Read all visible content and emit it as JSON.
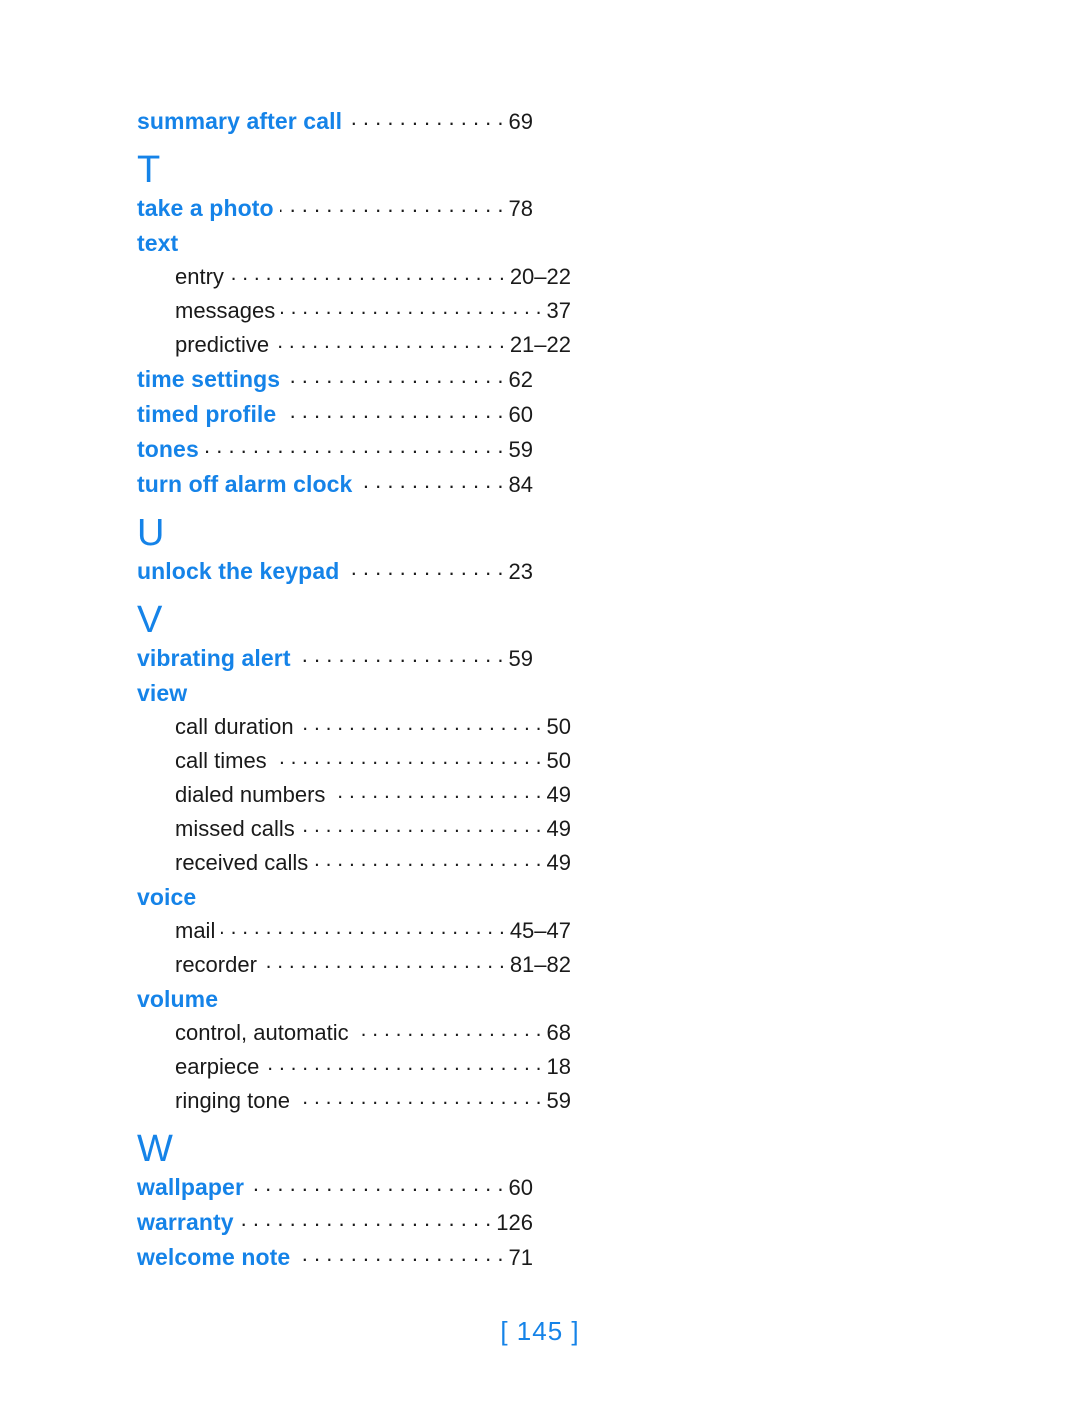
{
  "document": {
    "type": "index",
    "page_marker": "[ 145 ]"
  },
  "blocks": [
    {
      "kind": "entry",
      "level": "main",
      "label": "summary after call",
      "page": "69"
    },
    {
      "kind": "section",
      "letter": "T"
    },
    {
      "kind": "entry",
      "level": "main",
      "label": "take a photo",
      "page": "78"
    },
    {
      "kind": "group",
      "label": "text"
    },
    {
      "kind": "entry",
      "level": "sub",
      "label": "entry",
      "page": "20–22"
    },
    {
      "kind": "entry",
      "level": "sub",
      "label": "messages",
      "page": "37"
    },
    {
      "kind": "entry",
      "level": "sub",
      "label": "predictive",
      "page": "21–22"
    },
    {
      "kind": "entry",
      "level": "main",
      "label": "time settings",
      "page": "62"
    },
    {
      "kind": "entry",
      "level": "main",
      "label": "timed profile",
      "page": "60"
    },
    {
      "kind": "entry",
      "level": "main",
      "label": "tones",
      "page": "59"
    },
    {
      "kind": "entry",
      "level": "main",
      "label": "turn off alarm clock",
      "page": "84"
    },
    {
      "kind": "section",
      "letter": "U"
    },
    {
      "kind": "entry",
      "level": "main",
      "label": "unlock the keypad",
      "page": "23"
    },
    {
      "kind": "section",
      "letter": "V"
    },
    {
      "kind": "entry",
      "level": "main",
      "label": "vibrating alert",
      "page": "59"
    },
    {
      "kind": "group",
      "label": "view"
    },
    {
      "kind": "entry",
      "level": "sub",
      "label": "call duration",
      "page": "50"
    },
    {
      "kind": "entry",
      "level": "sub",
      "label": "call times",
      "page": "50"
    },
    {
      "kind": "entry",
      "level": "sub",
      "label": "dialed numbers",
      "page": "49"
    },
    {
      "kind": "entry",
      "level": "sub",
      "label": "missed calls",
      "page": "49"
    },
    {
      "kind": "entry",
      "level": "sub",
      "label": "received calls",
      "page": "49"
    },
    {
      "kind": "group",
      "label": "voice"
    },
    {
      "kind": "entry",
      "level": "sub",
      "label": "mail",
      "page": "45–47"
    },
    {
      "kind": "entry",
      "level": "sub",
      "label": "recorder",
      "page": "81–82"
    },
    {
      "kind": "group",
      "label": "volume"
    },
    {
      "kind": "entry",
      "level": "sub",
      "label": "control, automatic",
      "page": "68"
    },
    {
      "kind": "entry",
      "level": "sub",
      "label": "earpiece",
      "page": "18"
    },
    {
      "kind": "entry",
      "level": "sub",
      "label": "ringing tone",
      "page": "59"
    },
    {
      "kind": "section",
      "letter": "W"
    },
    {
      "kind": "entry",
      "level": "main",
      "label": "wallpaper",
      "page": "60"
    },
    {
      "kind": "entry",
      "level": "main",
      "label": "warranty",
      "page": "126"
    },
    {
      "kind": "entry",
      "level": "main",
      "label": "welcome note",
      "page": "71"
    }
  ],
  "colors": {
    "accent_blue": "#1583E8",
    "text_black": "#1a1a1a",
    "background": "#ffffff"
  }
}
